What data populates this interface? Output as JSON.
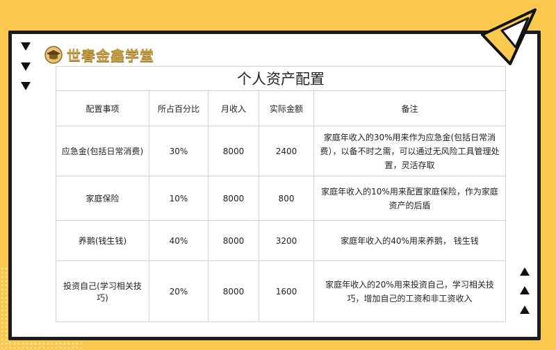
{
  "brand": {
    "name": "世春金鑫学堂"
  },
  "table": {
    "title": "个人资产配置",
    "headers": [
      "配置事项",
      "所占百分比",
      "月收入",
      "实际金额",
      "备注"
    ],
    "rows": [
      {
        "item": "应急金(包括日常消费)",
        "percent": "30%",
        "income": "8000",
        "amount": "2400",
        "note": "家庭年收入的30%用来作为应急金(包括日常消费），以备不时之需，可以通过无风险工具管理处置，灵活存取"
      },
      {
        "item": "家庭保险",
        "percent": "10%",
        "income": "8000",
        "amount": "800",
        "note": "家庭年收入的10%用来配置家庭保险，作为家庭资产的后盾"
      },
      {
        "item": "养鹅(钱生钱)",
        "percent": "40%",
        "income": "8000",
        "amount": "3200",
        "note": "家庭年收入的40%用来养鹅， 钱生钱"
      },
      {
        "item": "投资自己(学习相关技巧)",
        "percent": "20%",
        "income": "8000",
        "amount": "1600",
        "note": "家庭年收入的20%用来投资自己，学习相关技巧，增加自己的工资和非工资收入"
      }
    ]
  },
  "colors": {
    "background": "#fbc94e",
    "border": "#1c1c1c",
    "logo": "#c9a04a"
  },
  "icons": [
    "triangle-down-icon",
    "triangle-up-icon",
    "graduation-cap-icon"
  ]
}
